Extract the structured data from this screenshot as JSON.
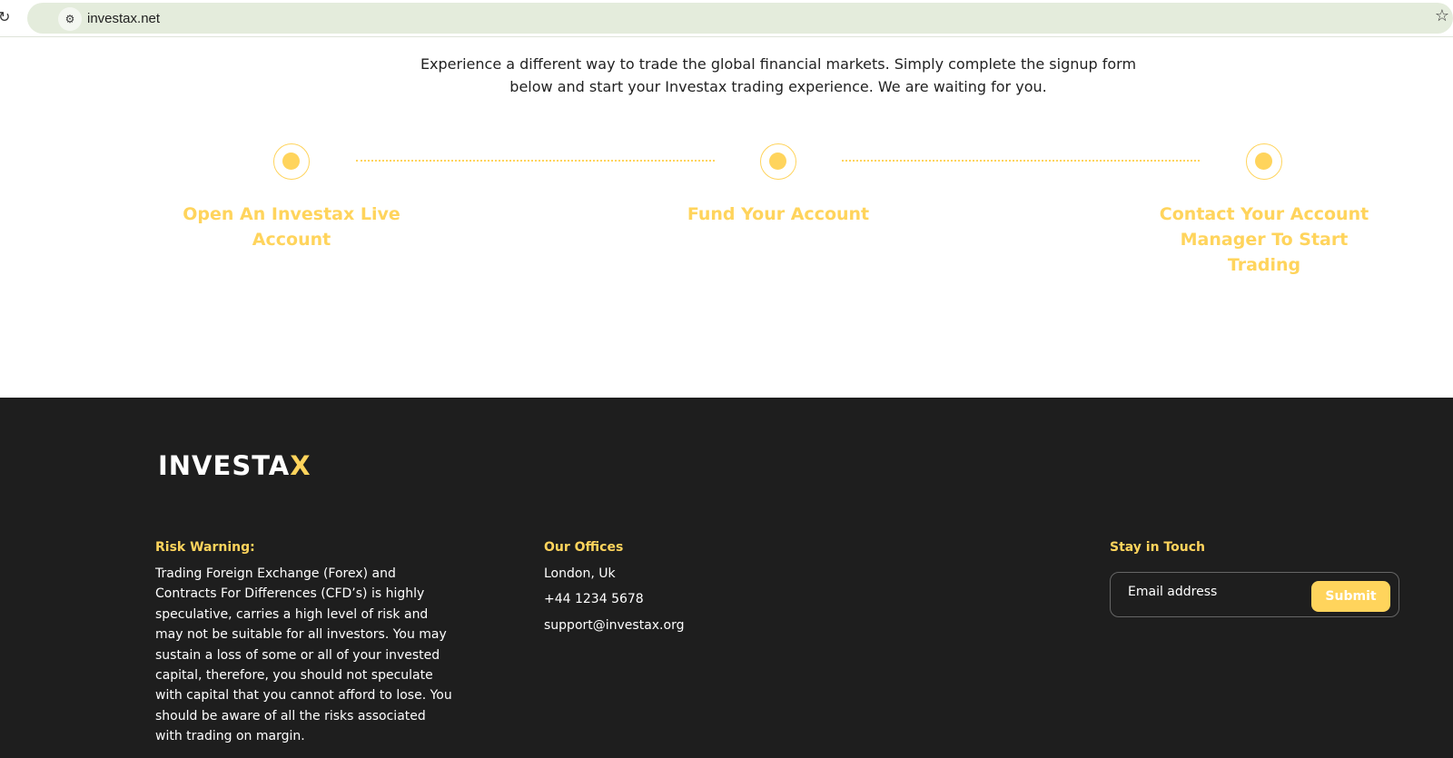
{
  "browser": {
    "url": "investax.net"
  },
  "intro": "Experience a different way to trade the global financial markets. Simply complete the signup form below and start your Investax trading experience. We are waiting for you.",
  "steps": [
    {
      "title": "Open An Investax Live Account"
    },
    {
      "title": "Fund Your Account"
    },
    {
      "title": "Contact Your Account Manager To Start Trading"
    }
  ],
  "footer": {
    "logo": "INVESTAX",
    "risk_heading": "Risk Warning:",
    "risk_text": "Trading Foreign Exchange (Forex) and Contracts For Differences (CFD’s) is highly speculative, carries a high level of risk and may not be suitable for all investors. You may sustain a loss of some or all of your invested capital, therefore, you should not speculate with capital that you cannot afford to lose. You should be aware of all the risks associated with trading on margin.",
    "offices_heading": "Our Offices",
    "location": "London, Uk",
    "phone": "+44 1234 5678",
    "email": "support@investax.org",
    "stay_heading": "Stay in Touch",
    "email_placeholder": "Email address",
    "submit": "Submit"
  },
  "colors": {
    "accent": "#ffd45c",
    "footer_bg": "#1e1e1e"
  }
}
